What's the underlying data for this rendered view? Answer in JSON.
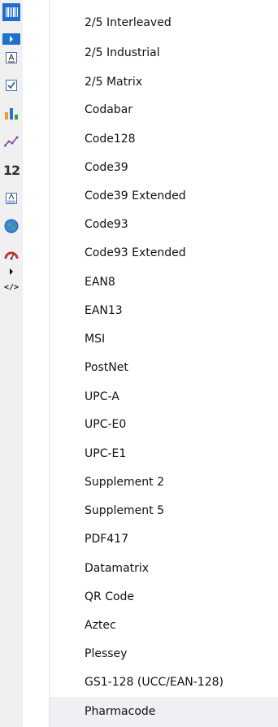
{
  "toolbar": {
    "icons": [
      "barcode-icon",
      "expand-arrow-icon",
      "label-icon",
      "checkbox-icon",
      "bar-chart-icon",
      "line-chart-icon",
      "number-icon",
      "image-text-icon",
      "globe-icon",
      "gauge-icon",
      "more-arrow-icon",
      "code-icon"
    ],
    "number_glyph": "12",
    "code_glyph": "</>",
    "accent_color": "#1e6fd0"
  },
  "menu": {
    "items": [
      "2/5 Interleaved",
      "2/5 Industrial",
      "2/5 Matrix",
      "Codabar",
      "Code128",
      "Code39",
      "Code39 Extended",
      "Code93",
      "Code93 Extended",
      "EAN8",
      "EAN13",
      "MSI",
      "PostNet",
      "UPC-A",
      "UPC-E0",
      "UPC-E1",
      "Supplement 2",
      "Supplement 5",
      "PDF417",
      "Datamatrix",
      "QR Code",
      "Aztec",
      "Plessey",
      "GS1-128 (UCC/EAN-128)",
      "Pharmacode"
    ],
    "highlighted_item": "Pharmacode"
  }
}
